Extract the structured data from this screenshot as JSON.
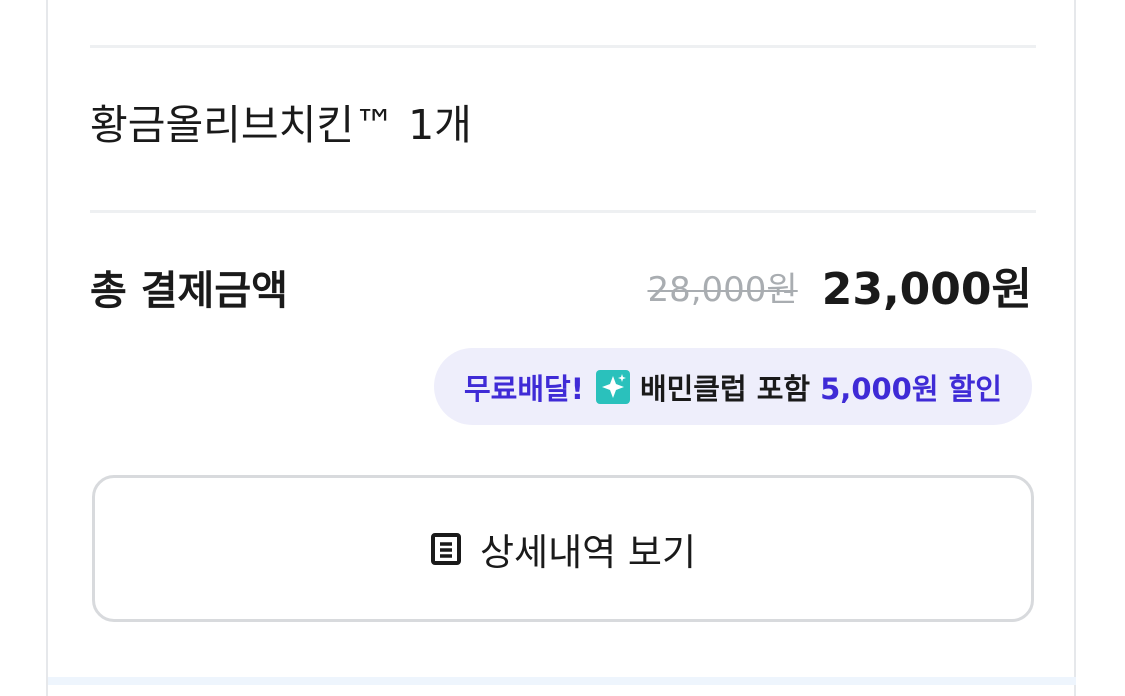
{
  "order": {
    "item_name": "황금올리브치킨™ 1개"
  },
  "total": {
    "label": "총 결제금액",
    "original_price": "28,000원",
    "final_price": "23,000원"
  },
  "discount": {
    "free_delivery": "무료배달!",
    "club_icon": "baemin-club-sparkle-icon",
    "club_text": "배민클럽 포함",
    "amount_text": "5,000원 할인"
  },
  "details_button": {
    "icon": "receipt-list-icon",
    "label": "상세내역 보기"
  },
  "colors": {
    "accent": "#3f2bd6",
    "pill_background": "#eeeefb",
    "club_icon_teal": "#2ac1bc",
    "strikethrough_gray": "#a9adb1",
    "text_dark": "#1a1a1a"
  }
}
